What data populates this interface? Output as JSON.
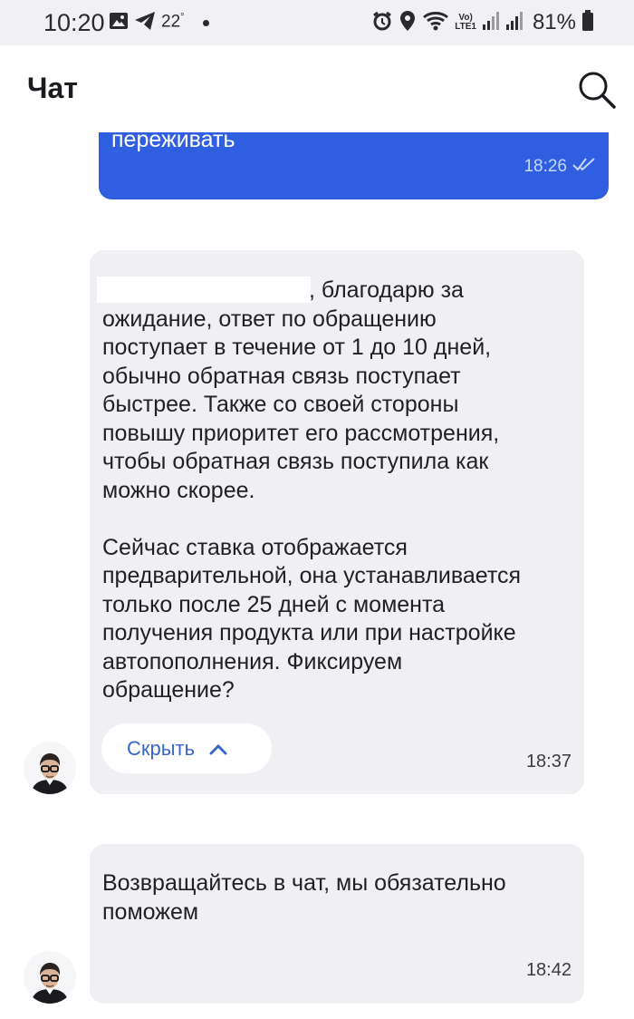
{
  "status_bar": {
    "time": "10:20",
    "temperature": "22",
    "degree": "°",
    "network_top": "Vo)",
    "network_bottom": "LTE1",
    "battery": "81%",
    "icons": [
      "image-icon",
      "telegram-icon",
      "dot-icon",
      "alarm-icon",
      "location-icon",
      "wifi-icon",
      "signal-icon",
      "signal-icon",
      "battery-icon"
    ]
  },
  "header": {
    "title": "Чат",
    "search_icon": "search-icon"
  },
  "messages": [
    {
      "direction": "outgoing",
      "text": "переживать",
      "time": "18:26",
      "status_icon": "double-check-icon"
    },
    {
      "direction": "incoming",
      "text_first_line": ", благодарю за",
      "text": "ожидание, ответ по обращению\nпоступает в течение от 1 до 10 дней,\nобычно обратная связь поступает\nбыстрее. Также со своей стороны\nповышу приоритет его рассмотрения,\nчтобы обратная связь поступила как\nможно скорее.\n\nСейчас ставка отображается\nпредварительной, она устанавливается\nтолько после 25 дней с момента\nполучения продукта или при настройке\nавтопополнения. Фиксируем\nобращение?",
      "hide_button_label": "Скрыть",
      "time": "18:37"
    },
    {
      "direction": "incoming",
      "text": "Возвращайтесь в чат, мы обязательно\nпоможем",
      "time": "18:42"
    }
  ],
  "colors": {
    "outgoing_bubble": "#2f5fe0",
    "incoming_bubble": "#efeff4",
    "link": "#3a66c8",
    "status_bar_bg": "#f1f1f4"
  }
}
